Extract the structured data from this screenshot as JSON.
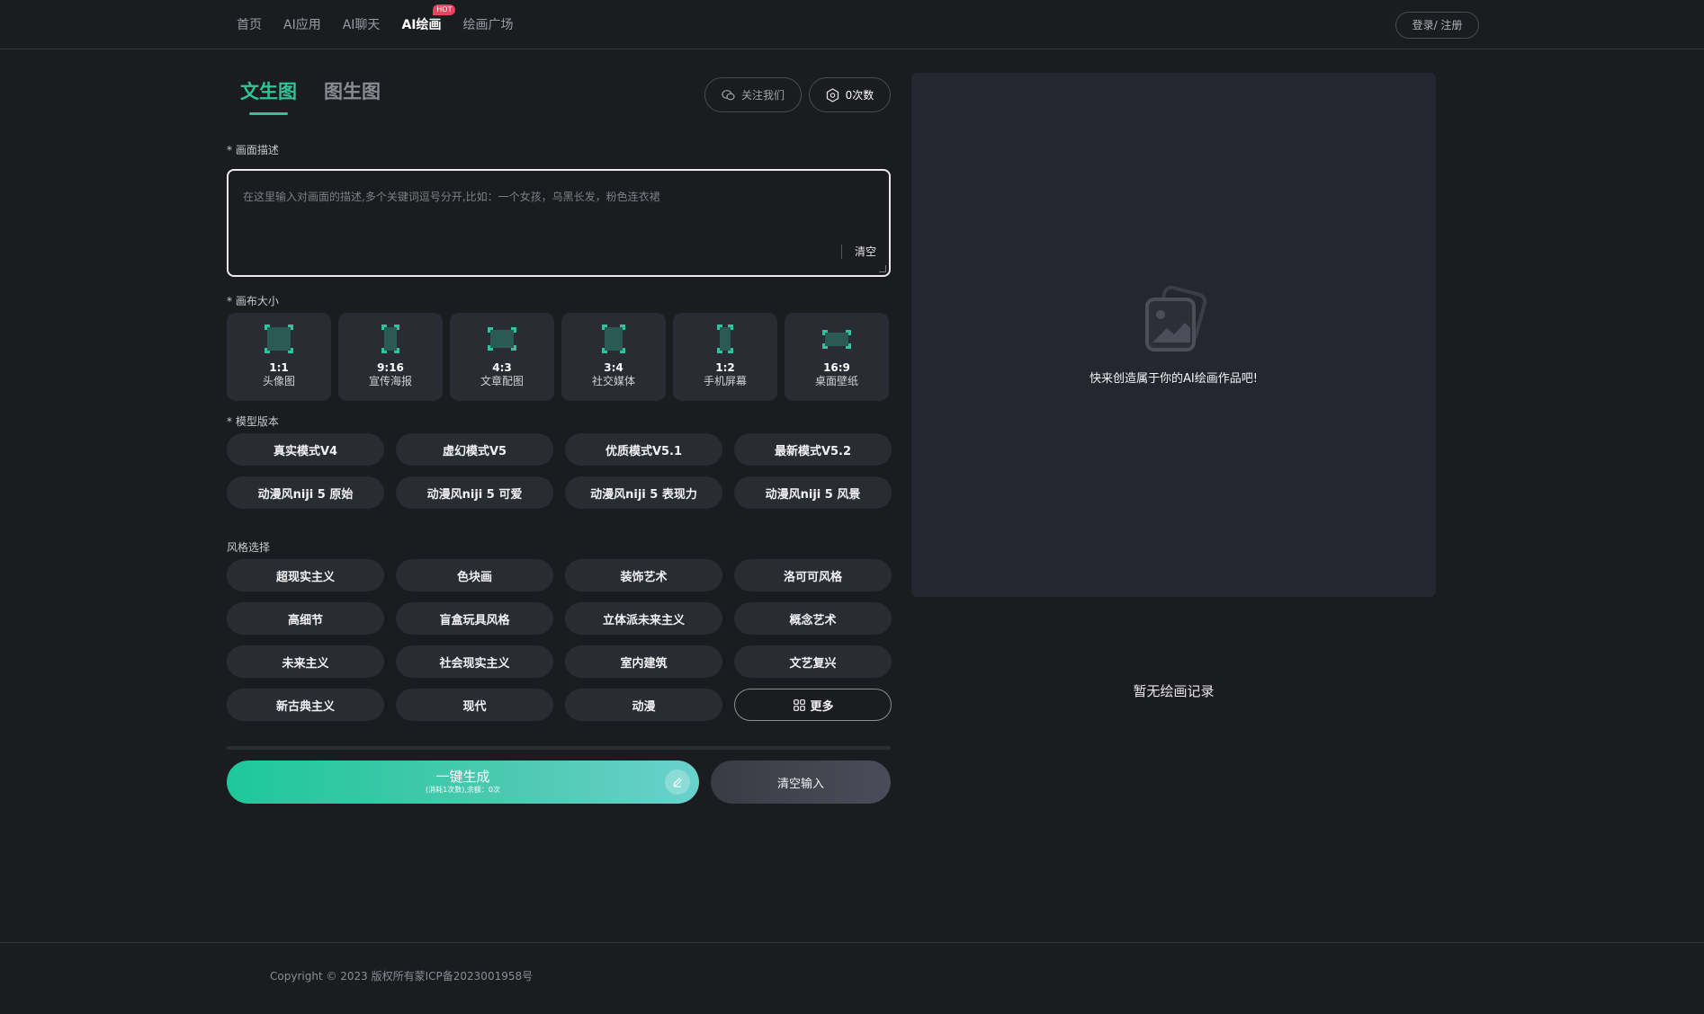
{
  "nav": {
    "items": [
      "首页",
      "AI应用",
      "AI聊天",
      "AI绘画",
      "绘画广场"
    ],
    "active_index": 3,
    "hot_badge": "HOT",
    "login_label": "登录/ 注册"
  },
  "tabs": {
    "text_to_image": "文生图",
    "image_to_image": "图生图"
  },
  "header_buttons": {
    "follow_label": "关注我们",
    "count_label": "0次数"
  },
  "prompt": {
    "label": "* 画面描述",
    "placeholder": "在这里输入对画面的描述,多个关键词逗号分开,比如：一个女孩，乌黑长发，粉色连衣裙",
    "value": "",
    "clear_label": "清空"
  },
  "canvas": {
    "label": "* 画布大小",
    "options": [
      {
        "ratio": "1:1",
        "name": "头像图"
      },
      {
        "ratio": "9:16",
        "name": "宣传海报"
      },
      {
        "ratio": "4:3",
        "name": "文章配图"
      },
      {
        "ratio": "3:4",
        "name": "社交媒体"
      },
      {
        "ratio": "1:2",
        "name": "手机屏幕"
      },
      {
        "ratio": "16:9",
        "name": "桌面壁纸"
      }
    ]
  },
  "model": {
    "label": "* 模型版本",
    "options": [
      "真实模式V4",
      "虚幻模式V5",
      "优质模式V5.1",
      "最新模式V5.2",
      "动漫风niji 5 原始",
      "动漫风niji 5 可爱",
      "动漫风niji 5 表现力",
      "动漫风niji 5 风景"
    ]
  },
  "style": {
    "label": "风格选择",
    "options": [
      "超现实主义",
      "色块画",
      "装饰艺术",
      "洛可可风格",
      "高细节",
      "盲盒玩具风格",
      "立体派未来主义",
      "概念艺术",
      "未来主义",
      "社会现实主义",
      "室内建筑",
      "文艺复兴",
      "新古典主义",
      "现代",
      "动漫"
    ],
    "more_label": "更多"
  },
  "actions": {
    "generate_label": "一键生成",
    "generate_sub": "(消耗1次数),余额：0次",
    "clear_input_label": "清空输入"
  },
  "preview": {
    "empty_text": "快来创造属于你的AI绘画作品吧!"
  },
  "history": {
    "empty_text": "暂无绘画记录"
  },
  "footer": {
    "copyright": "Copyright © 2023 版权所有蒙ICP备2023001958号"
  },
  "colors": {
    "accent": "#2fc496",
    "background": "#1b1c1f",
    "card": "#2a2c33",
    "hot": "#e9435d"
  },
  "icons": {
    "follow": "wechat-icon",
    "count": "hexagon-badge-icon",
    "more": "grid-icon",
    "generate": "pen-icon",
    "preview": "image-placeholder-icon"
  }
}
